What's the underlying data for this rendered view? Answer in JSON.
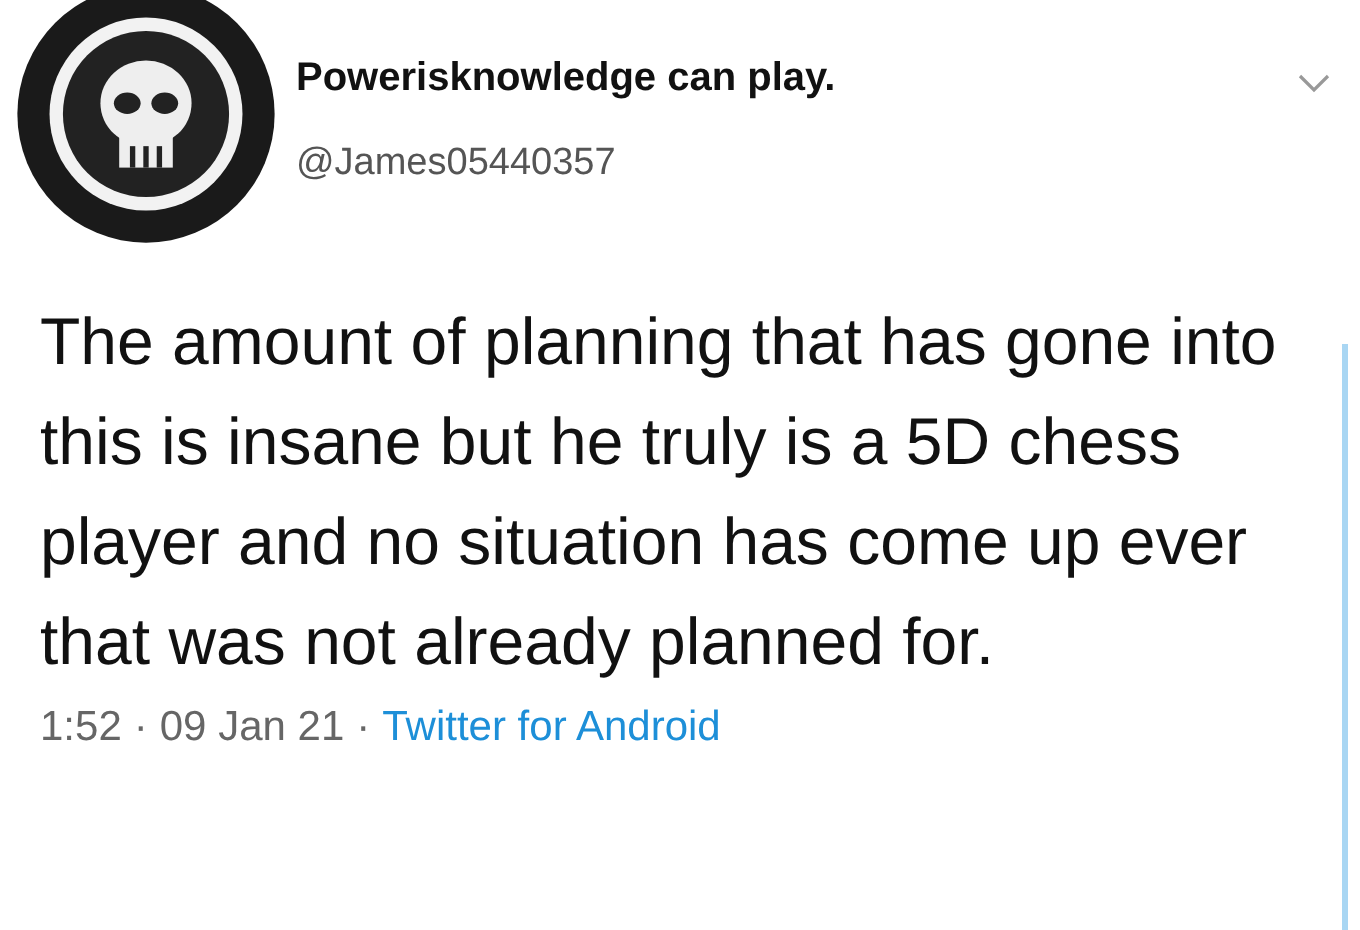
{
  "tweet": {
    "display_name": "Powerisknowledge can play.",
    "handle": "@James05440357",
    "text": "The amount of planning that has gone into this is insane but he truly is a 5D chess player and no situation has come up ever that was not already planned for.",
    "meta": {
      "time": "1:52",
      "separator": "·",
      "date": "09 Jan 21",
      "source": "Twitter for Android"
    }
  }
}
